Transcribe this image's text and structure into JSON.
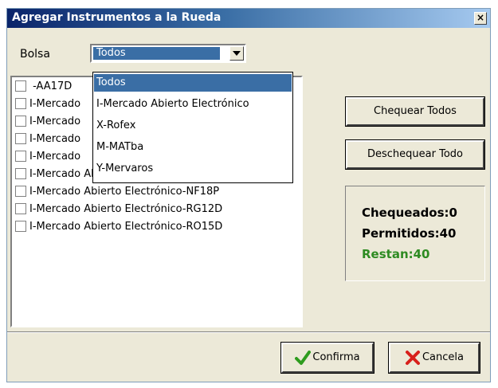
{
  "window": {
    "title": "Agregar Instrumentos a la Rueda",
    "close_glyph": "×"
  },
  "bolsa": {
    "label": "Bolsa",
    "selected": "Todos"
  },
  "dropdown": {
    "options": [
      "Todos",
      "I-Mercado Abierto Electrónico",
      "X-Rofex",
      "M-MATba",
      "Y-Mervaros"
    ]
  },
  "instruments": [
    " -AA17D",
    "I-Mercado",
    "I-Mercado",
    "I-Mercado",
    "I-Mercado",
    "I-Mercado Abierto Electrónico-BN",
    "I-Mercado Abierto Electrónico-NF18P",
    "I-Mercado Abierto Electrónico-RG12D",
    "I-Mercado Abierto Electrónico-RO15D"
  ],
  "buttons": {
    "check_all": "Chequear Todos",
    "uncheck_all": "Deschequear Todo",
    "confirm": "Confirma",
    "cancel": "Cancela"
  },
  "status": {
    "checked": "Chequeados:0",
    "allowed": "Permitidos:40",
    "remaining": "Restan:40"
  },
  "colors": {
    "title_start": "#0a246a",
    "title_end": "#a6caf0",
    "selection": "#3a6ea5",
    "remaining_text": "#2e8b22",
    "confirm_icon": "#2e9c1e",
    "cancel_icon": "#d8201b"
  }
}
